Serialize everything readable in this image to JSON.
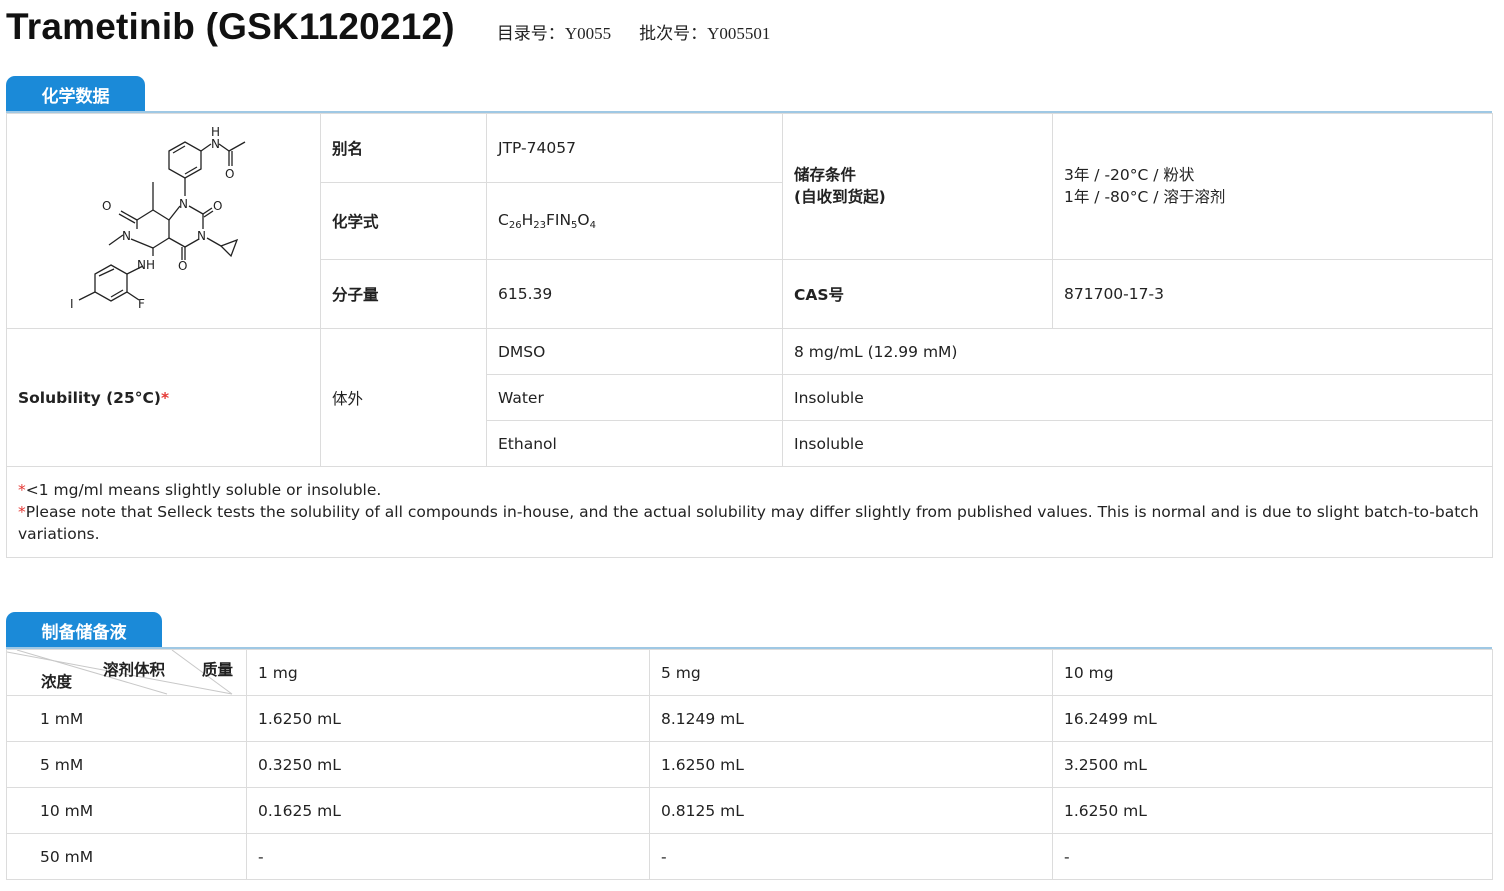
{
  "header": {
    "title": "Trametinib (GSK1120212)",
    "catalog_label": "目录号：",
    "catalog_value": "Y0055",
    "batch_label": "批次号：",
    "batch_value": "Y005501"
  },
  "chem_section": {
    "tab": "化学数据",
    "structure_atoms": [
      "H",
      "N",
      "O",
      "O",
      "N",
      "O",
      "N",
      "N",
      "NH",
      "O",
      "I",
      "F"
    ],
    "alias_label": "别名",
    "alias_value": "JTP-74057",
    "formula_label": "化学式",
    "formula_parts": [
      "C",
      "26",
      "H",
      "23",
      "FIN",
      "5",
      "O",
      "4"
    ],
    "mw_label": "分子量",
    "mw_value": "615.39",
    "storage_label_1": "储存条件",
    "storage_label_2": "(自收到货起)",
    "storage_1": "3年 / -20°C / 粉状",
    "storage_2": "1年 / -80°C / 溶于溶剂",
    "cas_label": "CAS号",
    "cas_value": "871700-17-3",
    "solubility_label": "Solubility (25°C)",
    "solubility_star": "*",
    "in_vitro_label": "体外",
    "solubility": [
      {
        "solvent": "DMSO",
        "value": "8 mg/mL (12.99 mM)"
      },
      {
        "solvent": "Water",
        "value": "Insoluble"
      },
      {
        "solvent": "Ethanol",
        "value": "Insoluble"
      }
    ],
    "note_star": "*",
    "note_1": "<1 mg/ml means slightly soluble or insoluble.",
    "note_2": "Please note that Selleck tests the solubility of all compounds in-house, and the actual solubility may differ slightly from published values. This is normal and is due to slight batch-to-batch variations."
  },
  "prep_section": {
    "tab": "制备储备液",
    "corner_mass": "质量",
    "corner_volume": "溶剂体积",
    "corner_conc": "浓度",
    "masses": [
      "1 mg",
      "5 mg",
      "10 mg"
    ],
    "rows": [
      {
        "conc": "1 mM",
        "values": [
          "1.6250 mL",
          "8.1249 mL",
          "16.2499 mL"
        ]
      },
      {
        "conc": "5 mM",
        "values": [
          "0.3250 mL",
          "1.6250 mL",
          "3.2500 mL"
        ]
      },
      {
        "conc": "10 mM",
        "values": [
          "0.1625 mL",
          "0.8125 mL",
          "1.6250 mL"
        ]
      },
      {
        "conc": "50 mM",
        "values": [
          "-",
          "-",
          "-"
        ]
      }
    ]
  },
  "colors": {
    "accent": "#1b8ad8",
    "star": "#e53935",
    "border": "#dcdcdc"
  }
}
